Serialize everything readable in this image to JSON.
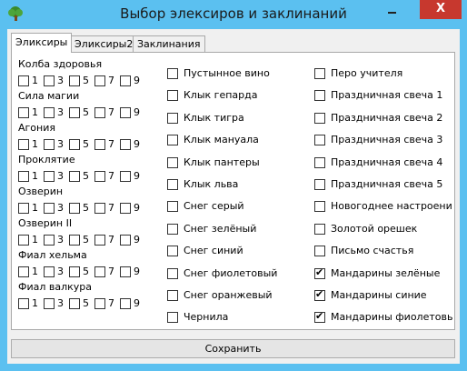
{
  "window": {
    "title": "Выбор элексиров и заклинаний",
    "close_label": "X"
  },
  "tabs": [
    "Эликсиры",
    "Эликсиры2",
    "Заклинания"
  ],
  "active_tab": 0,
  "level_options": [
    "1",
    "3",
    "5",
    "7",
    "9"
  ],
  "potions": [
    {
      "name": "Колба здоровья",
      "checked": [
        false,
        false,
        false,
        false,
        false
      ]
    },
    {
      "name": "Сила магии",
      "checked": [
        false,
        false,
        false,
        false,
        false
      ]
    },
    {
      "name": "Агония",
      "checked": [
        false,
        false,
        false,
        false,
        false
      ]
    },
    {
      "name": "Проклятие",
      "checked": [
        false,
        false,
        false,
        false,
        false
      ]
    },
    {
      "name": "Озверин",
      "checked": [
        false,
        false,
        false,
        false,
        false
      ]
    },
    {
      "name": "Озверин II",
      "checked": [
        false,
        false,
        false,
        false,
        false
      ]
    },
    {
      "name": "Фиал хельма",
      "checked": [
        false,
        false,
        false,
        false,
        false
      ]
    },
    {
      "name": "Фиал валкура",
      "checked": [
        false,
        false,
        false,
        false,
        false
      ]
    }
  ],
  "col2": [
    {
      "label": "Пустынное вино",
      "checked": false
    },
    {
      "label": "Клык гепарда",
      "checked": false
    },
    {
      "label": "Клык тигра",
      "checked": false
    },
    {
      "label": "Клык мануала",
      "checked": false
    },
    {
      "label": "Клык пантеры",
      "checked": false
    },
    {
      "label": "Клык льва",
      "checked": false
    },
    {
      "label": "Снег серый",
      "checked": false
    },
    {
      "label": "Снег зелёный",
      "checked": false
    },
    {
      "label": "Снег синий",
      "checked": false
    },
    {
      "label": "Снег фиолетовый",
      "checked": false
    },
    {
      "label": "Снег оранжевый",
      "checked": false
    },
    {
      "label": "Чернила",
      "checked": false
    }
  ],
  "col3": [
    {
      "label": "Перо учителя",
      "checked": false
    },
    {
      "label": "Праздничная свеча 1",
      "checked": false
    },
    {
      "label": "Праздничная свеча 2",
      "checked": false
    },
    {
      "label": "Праздничная свеча 3",
      "checked": false
    },
    {
      "label": "Праздничная свеча 4",
      "checked": false
    },
    {
      "label": "Праздничная свеча 5",
      "checked": false
    },
    {
      "label": "Новогоднее настроение",
      "checked": false
    },
    {
      "label": "Золотой орешек",
      "checked": false
    },
    {
      "label": "Письмо счастья",
      "checked": false
    },
    {
      "label": "Мандарины зелёные",
      "checked": true
    },
    {
      "label": "Мандарины синие",
      "checked": true
    },
    {
      "label": "Мандарины фиолетовые",
      "checked": true
    }
  ],
  "save_label": "Сохранить",
  "colors": {
    "titlebar": "#5bc0f0",
    "close": "#c7382e",
    "client": "#f0f0f0"
  },
  "icons": {
    "app": "tree-icon",
    "minimize": "minimize-icon",
    "close": "close-icon"
  }
}
